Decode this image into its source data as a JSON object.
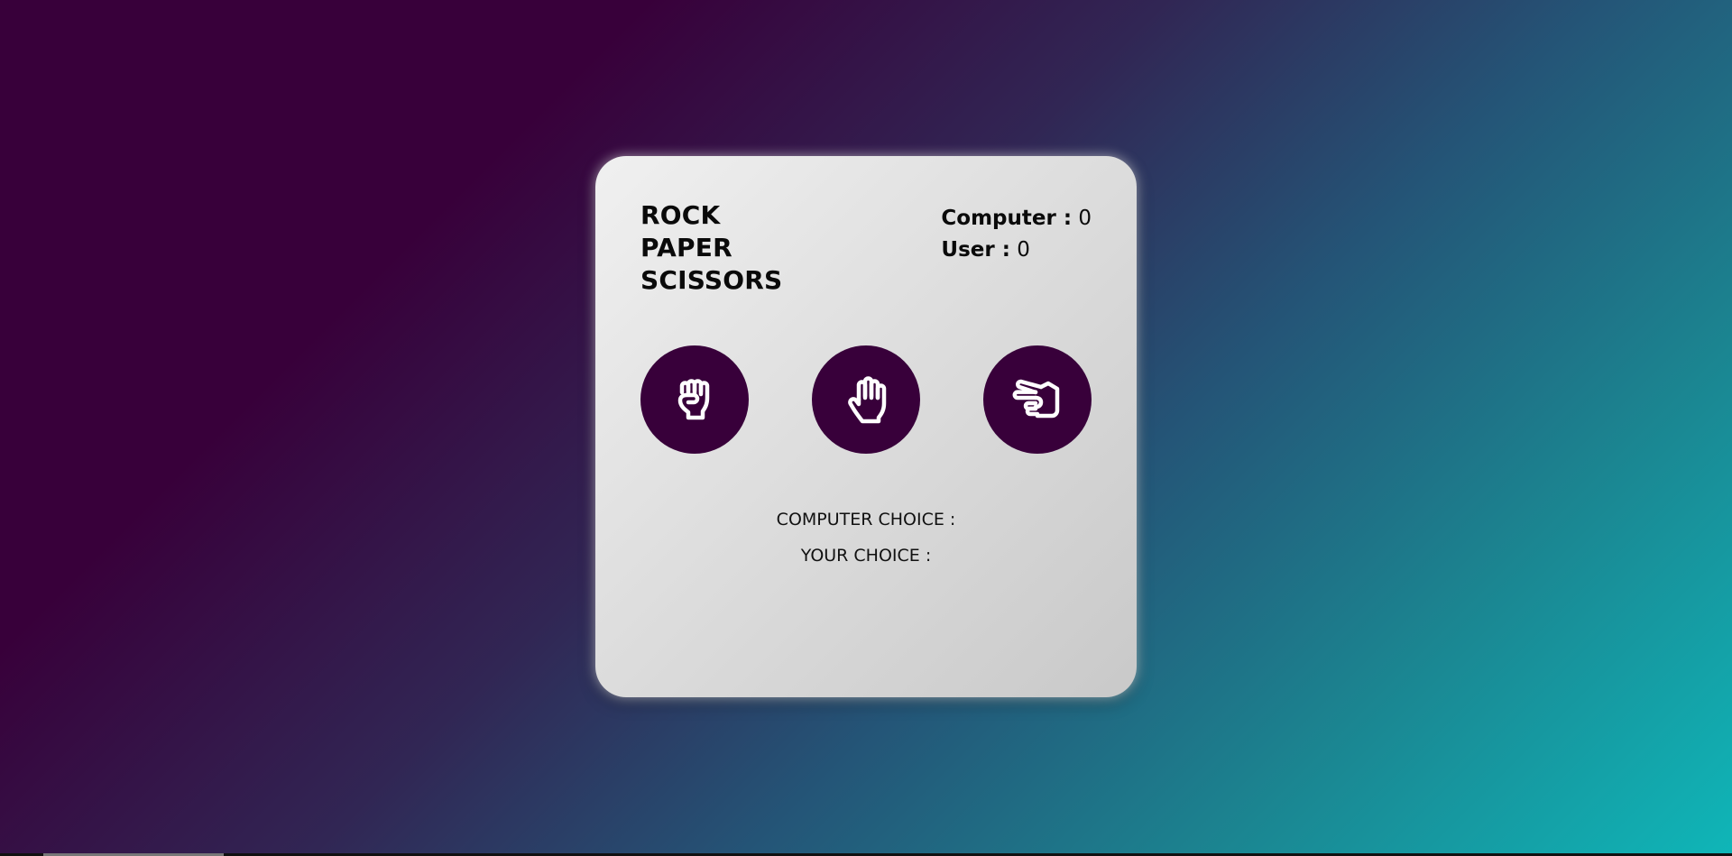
{
  "game": {
    "title_lines": [
      "ROCK",
      "PAPER",
      "SCISSORS"
    ],
    "scores": {
      "computer_label": "Computer :",
      "computer_value": "0",
      "user_label": "User :",
      "user_value": "0"
    },
    "choices": [
      {
        "id": "rock",
        "icon": "fist-icon"
      },
      {
        "id": "paper",
        "icon": "open-hand-icon"
      },
      {
        "id": "scissors",
        "icon": "scissors-hand-icon"
      }
    ],
    "computer_choice_label": "COMPUTER CHOICE :",
    "computer_choice_value": "",
    "your_choice_label": "YOUR CHOICE :",
    "your_choice_value": ""
  },
  "colors": {
    "accent": "#38003a",
    "card_light": "#f0f0f0",
    "card_dark": "#c9c9c9",
    "bg_start": "#38003a",
    "bg_end": "#0fb6b8"
  }
}
